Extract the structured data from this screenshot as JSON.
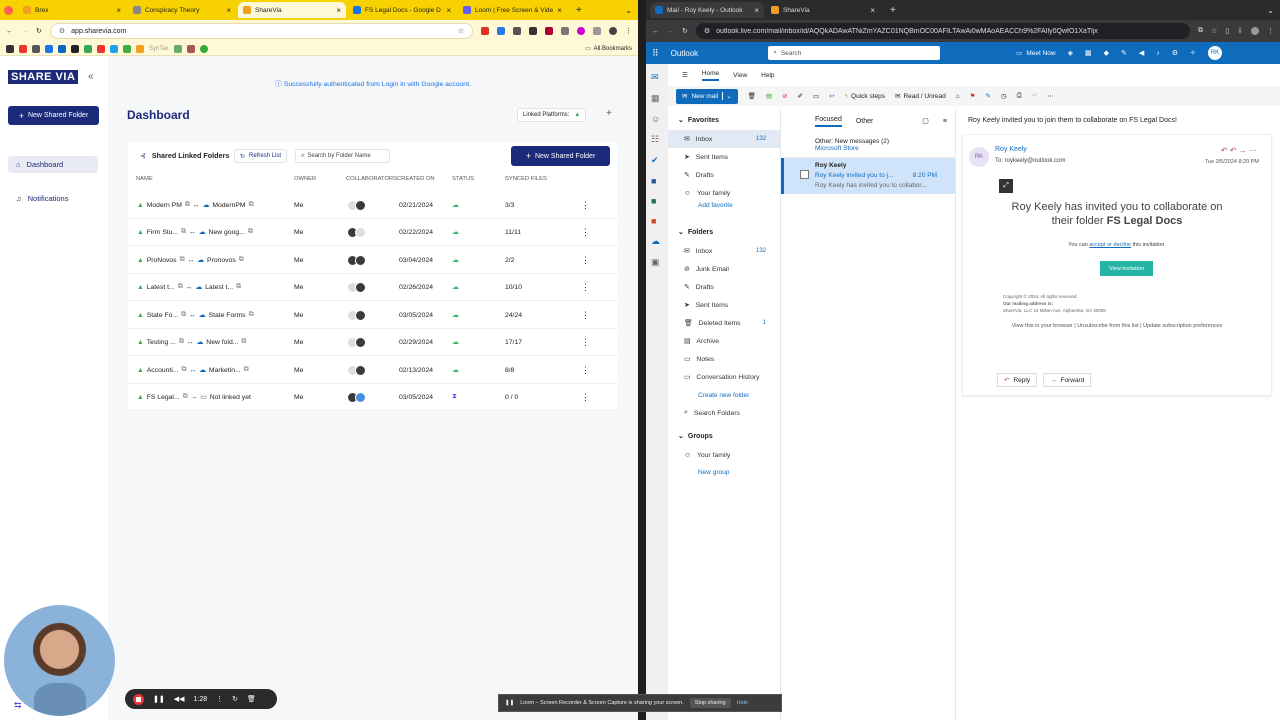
{
  "left_browser": {
    "tabs": [
      {
        "label": "Brex",
        "color": "#f0a020"
      },
      {
        "label": "Conspiracy Theory",
        "color": "#888888"
      },
      {
        "label": "ShareVia",
        "color": "#f0a020",
        "active": true
      },
      {
        "label": "FS Legal Docs - Google D",
        "color": "#1a73e8"
      },
      {
        "label": "Loom | Free Screen & Vide",
        "color": "#625df5"
      }
    ],
    "url": "app.sharevia.com",
    "bookmarks_label": "All Bookmarks",
    "bookmark_text": "SynTax"
  },
  "sharevia": {
    "logo": "SHARE VIA",
    "new_folder_label": "New Shared Folder",
    "nav": [
      {
        "label": "Dashboard"
      },
      {
        "label": "Notifications"
      }
    ],
    "success_msg": "Successfully authenticated from Login in with Google account.",
    "title": "Dashboard",
    "linked_platforms": "Linked Platforms:",
    "panel_title": "Shared Linked Folders",
    "refresh": "Refresh List",
    "search_placeholder": "Search by Folder Name",
    "new_folder_btn": "New Shared Folder",
    "columns": [
      "NAME",
      "OWNER",
      "COLLABORATORS",
      "CREATED ON",
      "STATUS",
      "SYNCED FILES"
    ],
    "rows": [
      {
        "src": "Modern PM",
        "dst": "ModernPM",
        "owner": "Me",
        "date": "02/21/2024",
        "synced": "3/3",
        "pending": false,
        "dst_type": "onedrive"
      },
      {
        "src": "Firm Stu...",
        "dst": "New goog...",
        "owner": "Me",
        "date": "02/22/2024",
        "synced": "11/11",
        "pending": false,
        "dst_type": "onedrive"
      },
      {
        "src": "ProNovos",
        "dst": "Pronovos",
        "owner": "Me",
        "date": "03/04/2024",
        "synced": "2/2",
        "pending": false,
        "dst_type": "onedrive"
      },
      {
        "src": "Latest t...",
        "dst": "Latest t...",
        "owner": "Me",
        "date": "02/26/2024",
        "synced": "10/10",
        "pending": false,
        "dst_type": "onedrive"
      },
      {
        "src": "State Fo...",
        "dst": "State Forms",
        "owner": "Me",
        "date": "03/05/2024",
        "synced": "24/24",
        "pending": false,
        "dst_type": "onedrive"
      },
      {
        "src": "Testing ...",
        "dst": "New fold...",
        "owner": "Me",
        "date": "02/29/2024",
        "synced": "17/17",
        "pending": false,
        "dst_type": "onedrive"
      },
      {
        "src": "Accounti...",
        "dst": "Marketin...",
        "owner": "Me",
        "date": "02/13/2024",
        "synced": "8/8",
        "pending": false,
        "dst_type": "onedrive"
      },
      {
        "src": "FS Legal...",
        "dst": "Not linked yet",
        "owner": "Me",
        "date": "03/05/2024",
        "synced": "0 / 0",
        "pending": true,
        "dst_type": "folder"
      }
    ]
  },
  "recorder": {
    "time": "1:28"
  },
  "right_browser": {
    "tabs": [
      {
        "label": "Mail - Roy Keely - Outlook",
        "color": "#0f6cbd",
        "active": true
      },
      {
        "label": "ShareVia",
        "color": "#f0a020"
      }
    ],
    "url": "outlook.live.com/mail/inbox/id/AQQkADAwATNiZmYAZC01NQBmOC00AFILTAwAi0wMAoAEACCh9%2FAIly0QwfO1XaTljx"
  },
  "outlook": {
    "app": "Outlook",
    "search": "Search",
    "meet_now": "Meet Now",
    "avatar": "RK",
    "ribbon_tabs": [
      "Home",
      "View",
      "Help"
    ],
    "new_mail": "New mail",
    "quick_steps": "Quick steps",
    "read_unread": "Read / Unread",
    "favorites_header": "Favorites",
    "favorites": [
      {
        "label": "Inbox",
        "count": "132"
      },
      {
        "label": "Sent Items",
        "count": ""
      },
      {
        "label": "Drafts",
        "count": ""
      },
      {
        "label": "Your family",
        "count": ""
      }
    ],
    "add_favorite": "Add favorite",
    "folders_header": "Folders",
    "folders": [
      {
        "label": "Inbox",
        "count": "132"
      },
      {
        "label": "Junk Email",
        "count": ""
      },
      {
        "label": "Drafts",
        "count": ""
      },
      {
        "label": "Sent Items",
        "count": ""
      },
      {
        "label": "Deleted Items",
        "count": "1"
      },
      {
        "label": "Archive",
        "count": ""
      },
      {
        "label": "Notes",
        "count": ""
      },
      {
        "label": "Conversation History",
        "count": ""
      },
      {
        "label": "Search Folders",
        "count": ""
      }
    ],
    "create_folder": "Create new folder",
    "groups_header": "Groups",
    "groups": [
      {
        "label": "Your family"
      }
    ],
    "new_group": "New group",
    "list_tabs": [
      "Focused",
      "Other"
    ],
    "other_msg": "Other: New messages (2)",
    "other_from": "Microsoft Store",
    "message": {
      "from": "Roy Keely",
      "subject": "Roy Keely invited you to j...",
      "time": "8:20 PM",
      "preview": "Roy Keely has invited you to collabor..."
    },
    "reading": {
      "subject": "Roy Keely invited you to join them to collaborate on FS Legal Docs!",
      "initials": "RK",
      "sender": "Roy Keely",
      "to": "To:  roykeely@outlook.com",
      "date": "Tue 3/5/2024 8:20 PM",
      "headline_1": "Roy Keely has invited you to collaborate on",
      "headline_2": "their folder ",
      "headline_bold": "FS Legal Docs",
      "invite_pre": "You can ",
      "invite_link": "accept or decline",
      "invite_post": " this invitation.",
      "button": "View invitation",
      "footer_1": "Copyright © 2024, All rights reserved.",
      "footer_2": "Our mailing address is:",
      "footer_3": "ShareVia, LLC 44 Milton Ave, Alpharetta, GA 30009",
      "footer_links": "View this in your browser | Unsubscribe from this list | Update subscription preferences",
      "reply": "Reply",
      "forward": "Forward"
    }
  },
  "loom_banner": {
    "text": "Loom – Screen Recorder & Screen Capture is sharing your screen.",
    "stop": "Stop sharing",
    "hide": "Hide"
  }
}
